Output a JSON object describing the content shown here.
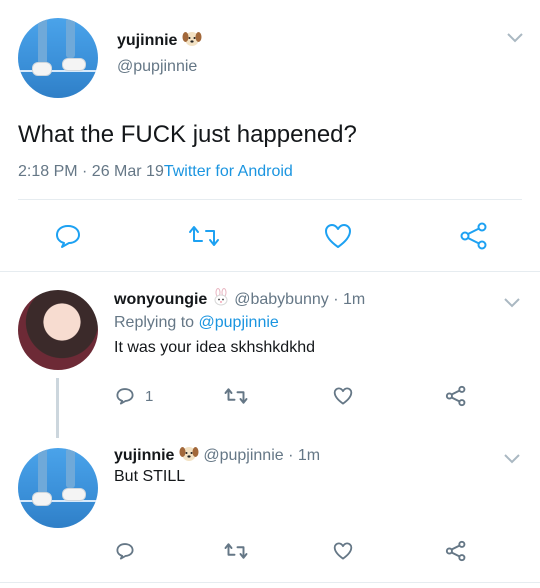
{
  "main_tweet": {
    "display_name": "yujinnie",
    "emoji": "dog-face",
    "handle": "@pupjinnie",
    "text": "What the FUCK just happened?",
    "time": "2:18 PM · 26 Mar 19",
    "source": "Twitter for Android"
  },
  "reply1": {
    "display_name": "wonyoungie",
    "emoji": "rabbit-face",
    "handle": "@babybunny",
    "age": "· 1m",
    "replying_prefix": "Replying to ",
    "replying_handle": "@pupjinnie",
    "text": "It was your idea skhshkdkhd",
    "reply_count": "1"
  },
  "reply2": {
    "display_name": "yujinnie",
    "emoji": "dog-face",
    "handle": "@pupjinnie",
    "age": "· 1m",
    "text": "But STILL"
  },
  "colors": {
    "accent": "#1b95e0",
    "secondary_text": "#657786",
    "icon": "#1da1f2",
    "divider": "#e6ecf0"
  }
}
